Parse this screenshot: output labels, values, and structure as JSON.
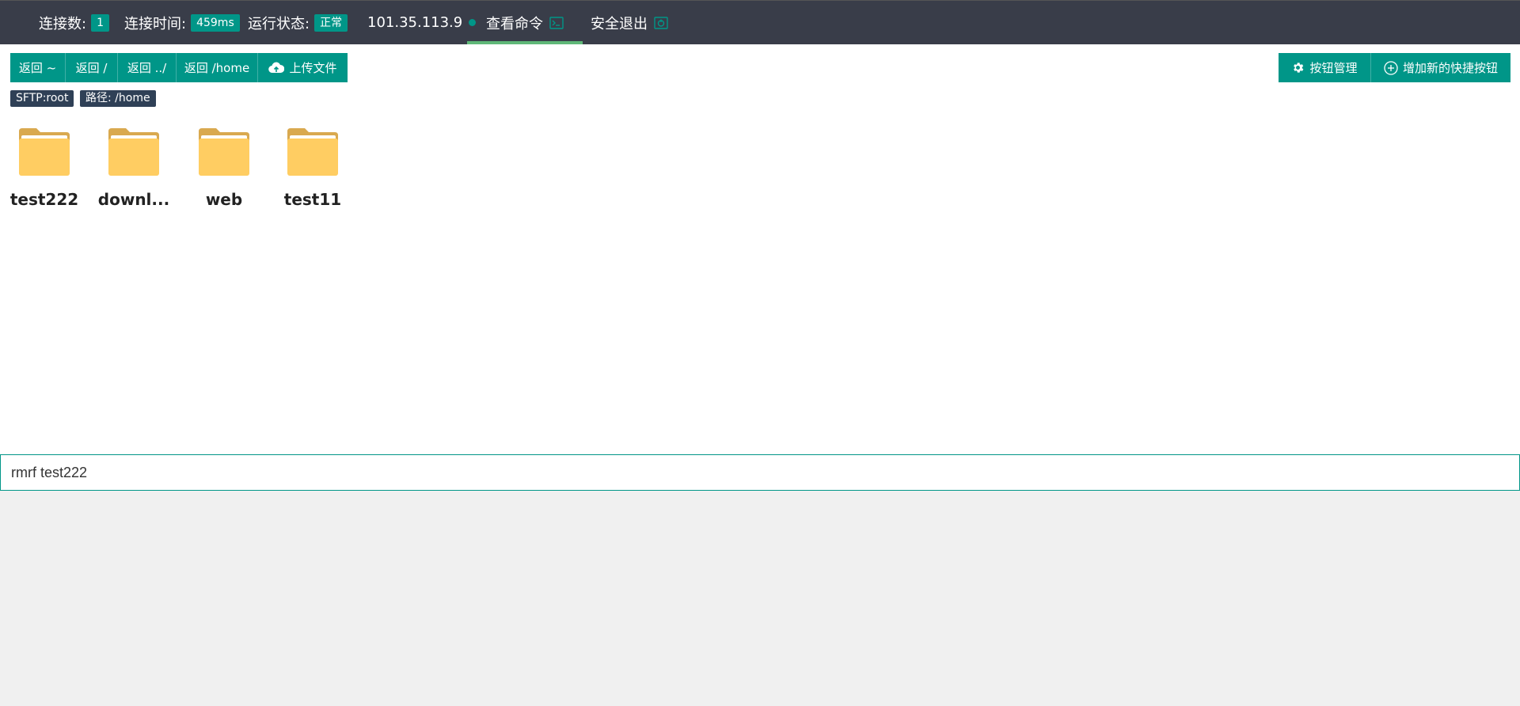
{
  "topbar": {
    "connections_label": "连接数:",
    "connections_value": "1",
    "conn_time_label": "连接时间:",
    "conn_time_value": "459ms",
    "status_label": "运行状态:",
    "status_value": "正常",
    "ip": "101.35.113.9",
    "view_commands": "查看命令",
    "logout": "安全退出",
    "accent": "#009688",
    "active_tab_underline": "#5fb878"
  },
  "toolbar": {
    "left_buttons": [
      {
        "label": "返回 ~"
      },
      {
        "label": "返回 /"
      },
      {
        "label": "返回 ../"
      },
      {
        "label": "返回 /home"
      },
      {
        "label": "上传文件",
        "icon": "cloud-upload-icon"
      }
    ],
    "right_buttons": [
      {
        "label": "按钮管理",
        "icon": "gear-icon"
      },
      {
        "label": "增加新的快捷按钮",
        "icon": "plus-circle-icon"
      }
    ]
  },
  "tags": {
    "sftp": "SFTP:root",
    "path": "路径: /home"
  },
  "files": [
    {
      "name": "test222",
      "icon": "folder-icon"
    },
    {
      "name": "downl...",
      "icon": "folder-icon"
    },
    {
      "name": "web",
      "icon": "folder-icon"
    },
    {
      "name": "test11",
      "icon": "folder-icon"
    }
  ],
  "command": {
    "value": "rmrf test222"
  }
}
